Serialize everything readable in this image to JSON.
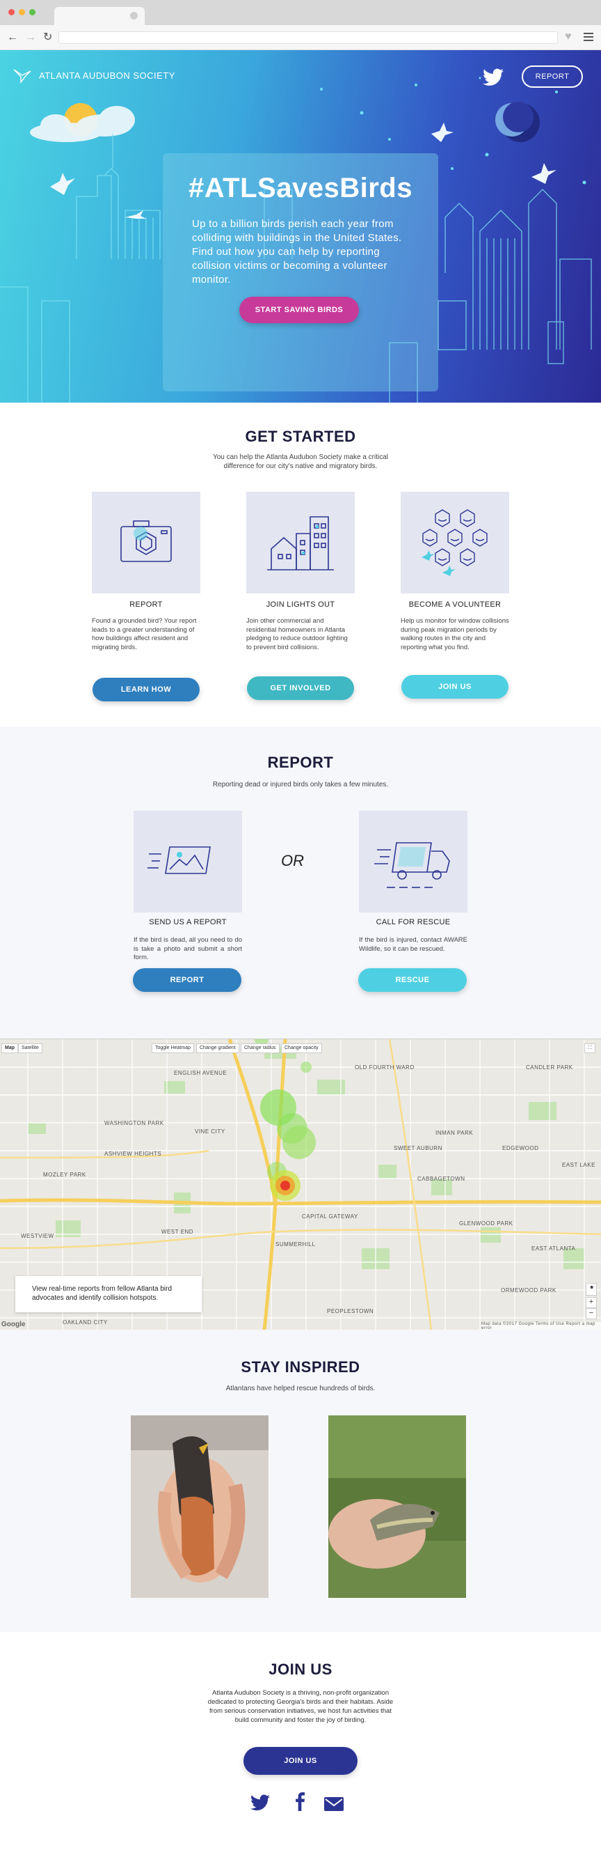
{
  "header": {
    "logo_text": "ATLANTA AUDUBON SOCIETY",
    "report_button": "REPORT"
  },
  "hero": {
    "title": "#ATLSavesBirds",
    "text": "Up to a billion birds perish each year from colliding with buildings in the United States. Find out how you can help by reporting collision victims or becoming a volunteer monitor.",
    "cta": "START SAVING BIRDS"
  },
  "get_started": {
    "title": "GET STARTED",
    "subtitle": "You can help the Atlanta Audubon Society make a critical difference for our city's native and migratory birds.",
    "cards": [
      {
        "title": "REPORT",
        "text": "Found a grounded bird? Your report leads to a greater understanding of how buildings affect resident and migrating birds.",
        "button": "LEARN HOW",
        "icon": "camera-icon"
      },
      {
        "title": "JOIN LIGHTS OUT",
        "text": "Join other commercial and residential homeowners in Atlanta pledging to reduce outdoor lighting to prevent bird collisions.",
        "button": "GET INVOLVED",
        "icon": "buildings-icon"
      },
      {
        "title": "BECOME A VOLUNTEER",
        "text": "Help us monitor for window collisions during peak migration periods by walking routes in the city and reporting what you find.",
        "button": "JOIN US",
        "icon": "volunteers-icon"
      }
    ]
  },
  "report": {
    "title": "REPORT",
    "subtitle": "Reporting dead or injured birds only takes a few minutes.",
    "or": "OR",
    "options": [
      {
        "title": "SEND US A REPORT",
        "text": "If the bird is dead, all you need to do is take a photo and submit a short form.",
        "button": "REPORT",
        "icon": "photo-upload-icon"
      },
      {
        "title": "CALL FOR RESCUE",
        "text": "If the bird is injured, contact AWARE Wildlife, so it can be rescued.",
        "button": "RESCUE",
        "icon": "van-icon"
      }
    ]
  },
  "map": {
    "type_buttons": [
      "Map",
      "Satellite"
    ],
    "controls": [
      "Toggle Heatmap",
      "Change gradient",
      "Change radius",
      "Change opacity"
    ],
    "info": "View real-time reports from fellow Atlanta bird advocates and identify collision hotspots.",
    "google": "Google",
    "footer_text": "Map data ©2017 Google   Terms of Use   Report a map error",
    "labels": [
      "ENGLISH AVENUE",
      "WASHINGTON PARK",
      "VINE CITY",
      "ASHVIEW HEIGHTS",
      "MOZLEY PARK",
      "WEST END",
      "SUMMERHILL",
      "OLD FOURTH WARD",
      "SWEET AUBURN",
      "INMAN PARK",
      "CABBAGETOWN",
      "EDGEWOOD",
      "GLENWOOD PARK",
      "EAST ATLANTA",
      "PEOPLESTOWN",
      "ORMEWOOD PARK",
      "WESTVIEW",
      "OAKLAND CITY",
      "CAPITAL GATEWAY",
      "CANDLER PARK",
      "EAST LAKE"
    ]
  },
  "inspired": {
    "title": "STAY INSPIRED",
    "subtitle": "Atlantans have helped rescue hundreds of birds."
  },
  "join": {
    "title": "JOIN US",
    "text": "Atlanta Audubon Society is a thriving, non-profit organization dedicated to protecting Georgia's birds and their habitats. Aside from serious conservation initiatives, we host fun activities that build community and foster the joy of birding.",
    "button": "JOIN US"
  },
  "colors": {
    "dark_navy": "#2c3493",
    "blue_button": "#2f7fbf",
    "teal_button": "#3fb8c4",
    "cyan_button": "#4fd0e2",
    "magenta": "#c83a9a"
  }
}
